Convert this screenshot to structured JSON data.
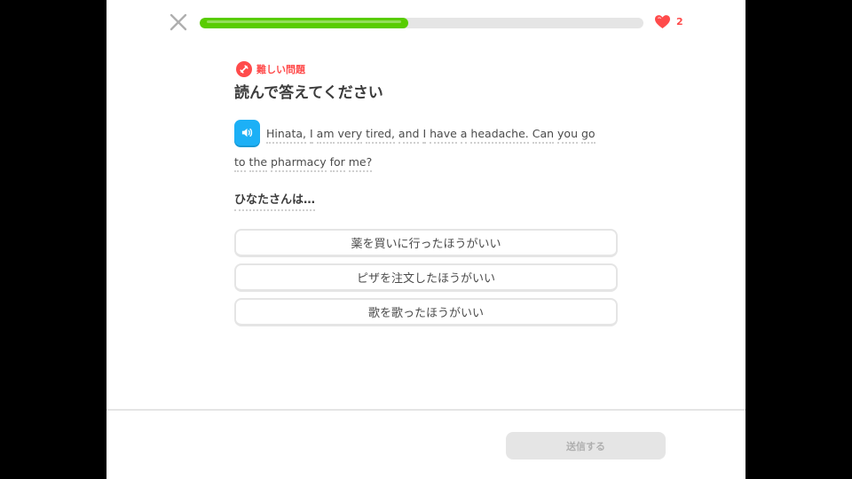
{
  "header": {
    "close_icon": "close-icon",
    "progress": 0.47,
    "hearts_icon": "heart-icon",
    "hearts_count": "2"
  },
  "challenge": {
    "badge_icon": "dumbbell-icon",
    "badge_label": "難しい問題",
    "title": "読んで答えてください",
    "speaker_icon": "speaker-icon",
    "passage_lines": [
      [
        "Hinata,",
        "I",
        "am",
        "very",
        "tired,",
        "and",
        "I",
        "have",
        "a",
        "headache.",
        "Can",
        "you",
        "go"
      ],
      [
        "to",
        "the",
        "pharmacy",
        "for",
        "me?"
      ]
    ],
    "question": "ひなたさんは…"
  },
  "options": [
    "薬を買いに行ったほうがいい",
    "ピザを注文したほうがいい",
    "歌を歌ったほうがいい"
  ],
  "footer": {
    "submit_label": "送信する"
  },
  "colors": {
    "progress": "#58cc02",
    "heart": "#ff4b4b",
    "speaker": "#1cb0f6",
    "badge": "#ff4b4b"
  }
}
